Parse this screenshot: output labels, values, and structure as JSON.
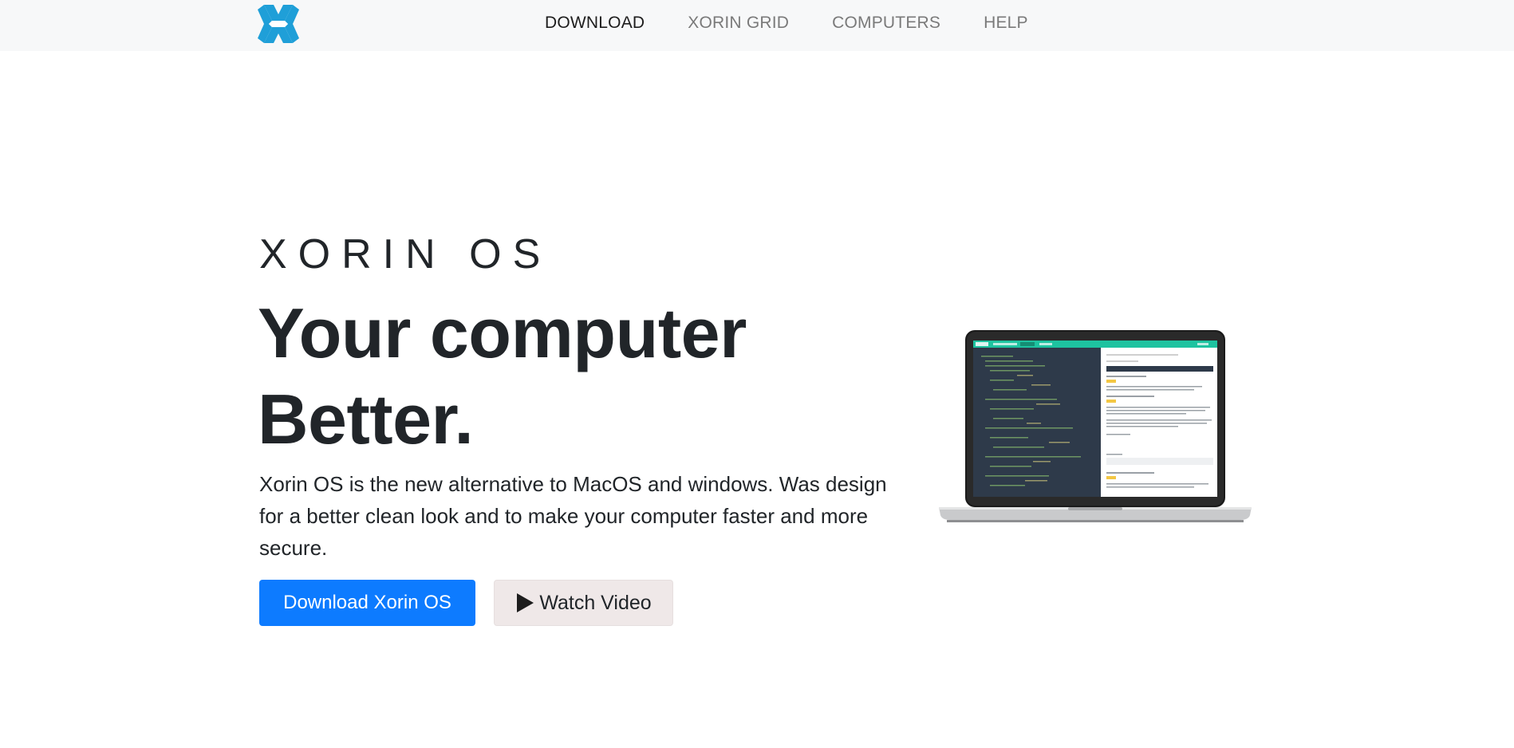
{
  "nav": {
    "logo_alt": "Xorin logo",
    "links": [
      {
        "label": "DOWNLOAD",
        "active": true
      },
      {
        "label": "XORIN GRID",
        "active": false
      },
      {
        "label": "COMPUTERS",
        "active": false
      },
      {
        "label": "HELP",
        "active": false
      }
    ]
  },
  "hero": {
    "eyebrow": "XORIN OS",
    "headline_line1": "Your computer",
    "headline_line2": "Better.",
    "description": "Xorin OS is the new alternative to MacOS and windows. Was design for a better clean look and to make your computer faster and more secure.",
    "primary_button": "Download Xorin OS",
    "secondary_button": "Watch Video",
    "secondary_icon": "play-icon"
  },
  "colors": {
    "brand": "#1f9fd8",
    "primary_button": "#0d7bff",
    "secondary_button": "#efe8e8",
    "navbar_bg": "#f7f8f9",
    "screen_header": "#1ec3a0",
    "code_bg": "#2e3a4a"
  }
}
